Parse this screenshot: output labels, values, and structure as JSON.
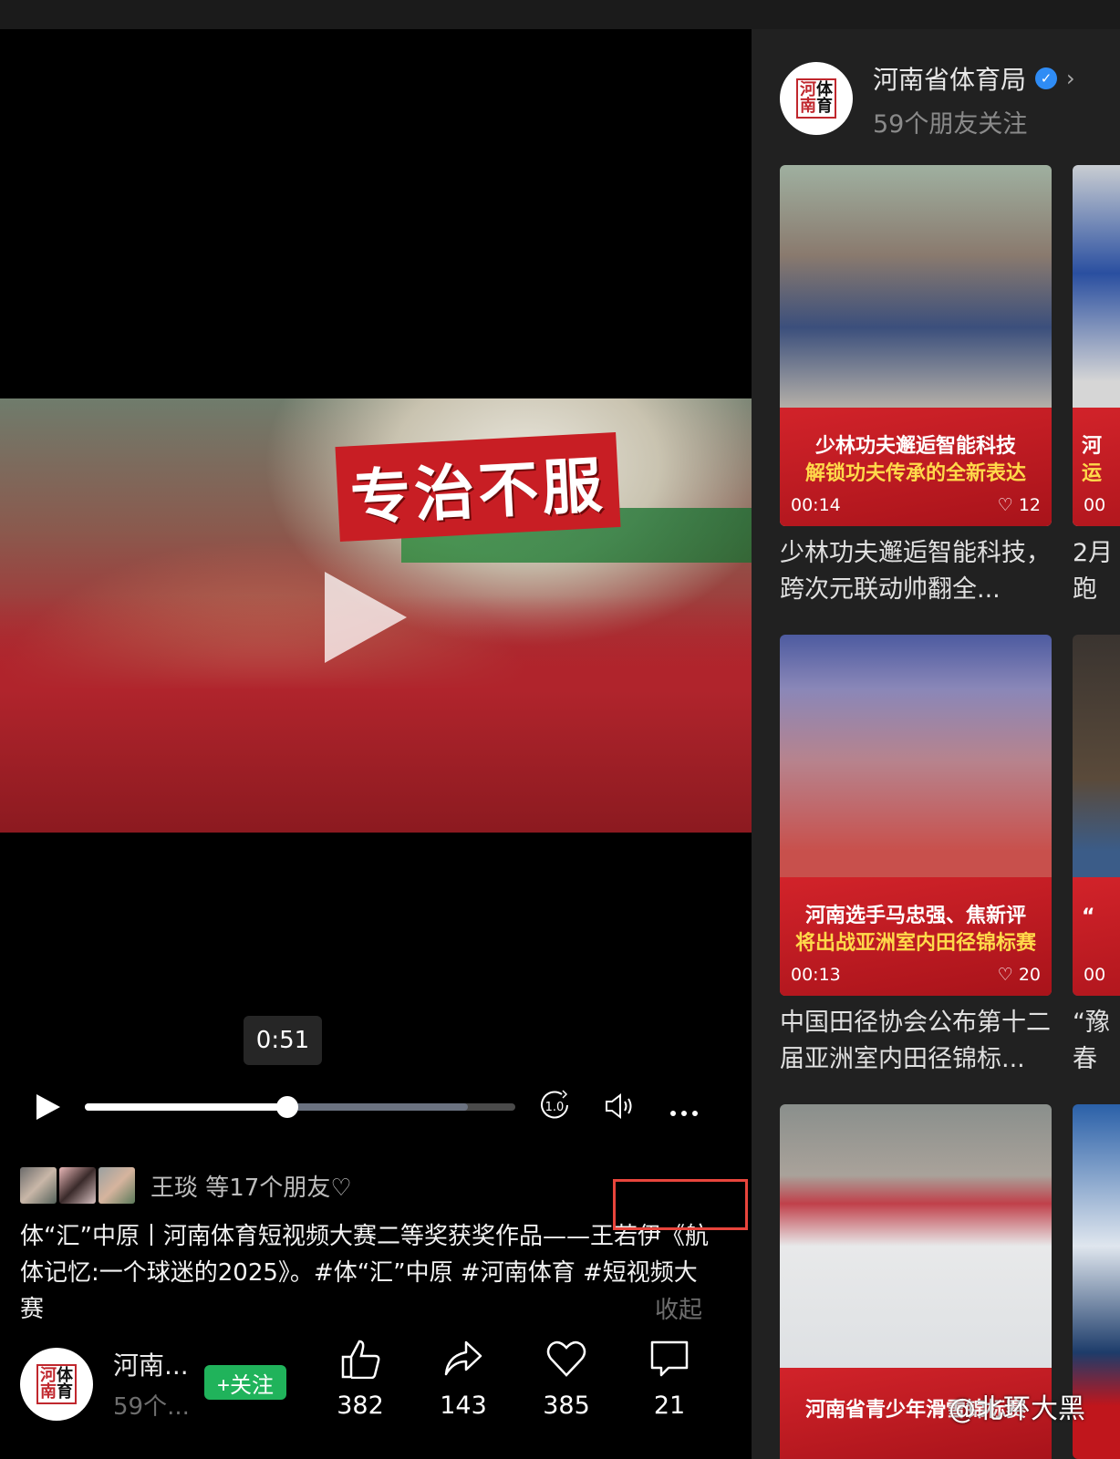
{
  "player": {
    "frame_caption": "专治不服",
    "tooltip_time": "0:51",
    "progress": 0.47,
    "buffered": 0.89,
    "speed_label": "1.0"
  },
  "social": {
    "friends_text": "王琰 等17个朋友♡"
  },
  "description": {
    "text": "体“汇”中原丨河南体育短视频大赛二等奖获奖作品——王若伊《航体记忆:一个球迷的2025》。#体“汇”中原 #河南体育 #短视频大赛",
    "collapse_label": "收起"
  },
  "author": {
    "name": "河南...",
    "followers": "59个...",
    "follow_label": "+关注",
    "logo_text": [
      "河",
      "体",
      "南",
      "育"
    ]
  },
  "actions": {
    "like": "382",
    "share": "143",
    "favorite": "385",
    "comment": "21"
  },
  "sidebar": {
    "name": "河南省体育局",
    "sub": "59个朋友关注",
    "cards": [
      {
        "line1": "少林功夫邂逅智能科技",
        "line2": "解锁功夫传承的全新表达",
        "duration": "00:14",
        "likes": "12",
        "title": "少林功夫邂逅智能科技，跨次元联动帅翻全..."
      },
      {
        "line1": "河",
        "line2": "运",
        "duration": "00",
        "likes": "",
        "title": "2月",
        "title2": "跑"
      },
      {
        "line1": "河南选手马忠强、焦新评",
        "line2": "将出战亚洲室内田径锦标赛",
        "duration": "00:13",
        "likes": "20",
        "title": "中国田径协会公布第十二届亚洲室内田径锦标..."
      },
      {
        "line1": "“",
        "line2": "",
        "duration": "00",
        "likes": "",
        "title": "“豫",
        "title2": "春"
      },
      {
        "line1": "河南省青少年滑雪锦标赛",
        "line2": "",
        "duration": "",
        "likes": "",
        "title": ""
      }
    ]
  },
  "watermark": "@北环大黑"
}
